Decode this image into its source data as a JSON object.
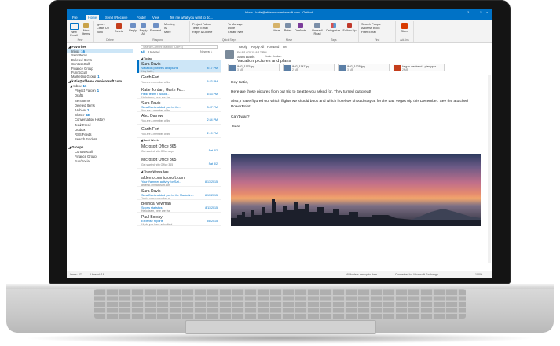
{
  "window": {
    "title": "Inbox - katie@afdemo.onmicrosoft.com - Outlook",
    "controls": [
      "?",
      "–",
      "□",
      "×"
    ]
  },
  "tabs": [
    "File",
    "Home",
    "Send / Receive",
    "Folder",
    "View",
    "Tell me what you want to do..."
  ],
  "ribbon": {
    "new_group": {
      "new_email": "New Email",
      "new_items": "New Items",
      "label": "New"
    },
    "delete_group": {
      "ignore": "Ignore",
      "clean_up": "Clean Up",
      "junk": "Junk",
      "delete": "Delete",
      "label": "Delete"
    },
    "respond_group": {
      "reply": "Reply",
      "reply_all": "Reply All",
      "forward": "Forward",
      "meeting": "Meeting",
      "im": "IM",
      "more": "More",
      "label": "Respond"
    },
    "quick_steps": {
      "items": [
        "Project Falcon",
        "Team Email",
        "Reply & Delete",
        "To Manager",
        "Done",
        "Create New"
      ],
      "label": "Quick Steps"
    },
    "move_group": {
      "move": "Move",
      "rules": "Rules",
      "onenote": "OneNote",
      "label": "Move"
    },
    "tags_group": {
      "unread_read": "Unread/ Read",
      "categorize": "Categorize",
      "follow_up": "Follow Up",
      "label": "Tags"
    },
    "find_group": {
      "search_people": "Search People",
      "address_book": "Address Book",
      "filter_email": "Filter Email",
      "label": "Find"
    },
    "store_group": {
      "store": "Store",
      "label": "Add-ins"
    }
  },
  "nav": {
    "favorites_header": "◢ Favorites",
    "favorites": [
      {
        "label": "Inbox",
        "count": "16",
        "selected": true
      },
      {
        "label": "Sent Items",
        "count": ""
      },
      {
        "label": "Deleted Items",
        "count": ""
      },
      {
        "label": "ContosoGolf",
        "count": ""
      },
      {
        "label": "Finance Group",
        "count": ""
      },
      {
        "label": "Fun/Social",
        "count": ""
      },
      {
        "label": "Marketing Group",
        "count": "1"
      }
    ],
    "account_header": "◢ katie@afdemo.onmicrosoft.com",
    "account_items": [
      {
        "label": "◢ Inbox",
        "count": "16"
      },
      {
        "label": "Project Falcon",
        "count": "1"
      },
      {
        "label": "Drafts",
        "count": ""
      },
      {
        "label": "Sent Items",
        "count": ""
      },
      {
        "label": "Deleted Items",
        "count": ""
      },
      {
        "label": "Archive",
        "count": "1"
      },
      {
        "label": "Clutter",
        "count": "40"
      },
      {
        "label": "Conversation History",
        "count": ""
      },
      {
        "label": "Junk Email",
        "count": ""
      },
      {
        "label": "Outbox",
        "count": ""
      },
      {
        "label": "RSS Feeds",
        "count": ""
      },
      {
        "label": "Search Folders",
        "count": ""
      }
    ],
    "groups_header": "◢ Groups",
    "groups": [
      "ContosoGolf",
      "Finance Group",
      "Fun/Social"
    ]
  },
  "list": {
    "search_placeholder": "Search Current Mailbox (Ctrl+E)",
    "search_scope": "Current Mailbox",
    "filter_all": "All",
    "filter_unread": "Unread",
    "sort": "Newest ↓",
    "groups": {
      "today": "◢ Today",
      "last_week": "◢ Last Week",
      "three_weeks": "◢ Three Weeks Ago"
    },
    "today": [
      {
        "from": "Sara Davis",
        "subject": "Vacation pictures and plans",
        "time": "8:17 PM",
        "preview": "Hey Katie,",
        "selected": true
      },
      {
        "from": "Garth Fort",
        "subject": "",
        "time": "6:33 PM",
        "preview": "You are a member of the"
      },
      {
        "from": "Katie Jordan; Garth Fo...",
        "subject": "Hello team! I would...",
        "time": "6:33 PM",
        "preview": "Hello team, here are five"
      },
      {
        "from": "Sara Davis",
        "subject": "Sara Davis added you to the...",
        "time": "3:47 PM",
        "preview": "You are a member of the"
      },
      {
        "from": "Alex Darrow",
        "subject": "",
        "time": "2:34 PM",
        "preview": "You are a member of the"
      },
      {
        "from": "Garth Fort",
        "subject": "",
        "time": "2:19 PM",
        "preview": "You are a member of the"
      }
    ],
    "last_week": [
      {
        "from": "Microsoft Office 365",
        "subject": "",
        "time": "Sat 3/2",
        "preview": "Get started with Office apps"
      },
      {
        "from": "Microsoft Office 365",
        "subject": "",
        "time": "Sat 3/2",
        "preview": "Get started with Office 365"
      }
    ],
    "three_weeks": [
      {
        "from": "afdemo.onmicrosoft.com",
        "subject": "Your Yammer activity for Sat...",
        "time": "8/13/2015",
        "preview": "afdemo.onmicrosoft.com"
      },
      {
        "from": "Sara Davis",
        "subject": "Sara Davis added you to the Marketin...",
        "time": "8/13/2015",
        "preview": "You're now a member of"
      },
      {
        "from": "Belinda Newman",
        "subject": "Sports statistics",
        "time": "8/11/2015",
        "preview": "Hello team, here are five"
      },
      {
        "from": "Paul Borsky",
        "subject": "Expense reports",
        "time": "8/8/2015",
        "preview": "Hi, do you have submitted"
      }
    ]
  },
  "reading": {
    "toolbar": {
      "reply": "Reply",
      "reply_all": "Reply All",
      "forward": "Forward",
      "im": "IM"
    },
    "date": "Fri 8/14/2015 8:17 PM",
    "sender": "Sara Davis",
    "subject": "Vacation pictures and plans",
    "to": "Katie Jordan",
    "attachments": [
      {
        "name": "IMG_1175.jpg",
        "size": "3 MB"
      },
      {
        "name": "IMG_1147.jpg",
        "size": "2 MB"
      },
      {
        "name": "IMG_1025.jpg",
        "size": "3 MB"
      },
      {
        "name": "Vegas weekend - plan.pptx",
        "size": "2 MB"
      }
    ],
    "body": [
      "Hey Katie,",
      "Here are those pictures from our trip to Seattle you asked for. They turned out great!",
      "Also, I have figured out which flights we should book and which hotel we should stay at for the Las Vegas trip this December. See the attached PowerPoint.",
      "Can't wait?",
      "-Sara"
    ]
  },
  "status": {
    "items": "Items: 27",
    "unread": "Unread: 16",
    "folders": "All folders are up to date.",
    "connected": "Connected to: Microsoft Exchange",
    "zoom": "100%"
  }
}
